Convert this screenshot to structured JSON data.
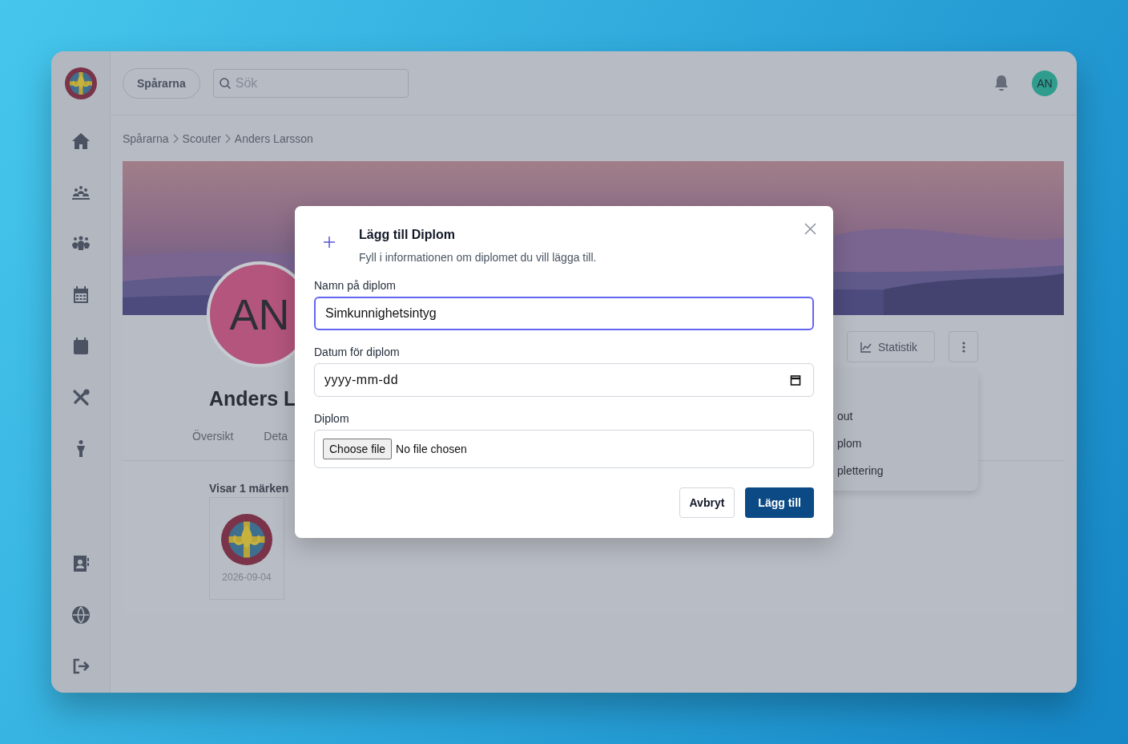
{
  "header": {
    "org_button": "Spårarna",
    "search": {
      "placeholder": "Sök"
    },
    "user_initials": "AN"
  },
  "breadcrumb": [
    "Spårarna",
    "Scouter",
    "Anders Larsson"
  ],
  "profile": {
    "avatar_initials": "AN",
    "name": "Anders L",
    "tabs": [
      "Översikt",
      "Deta"
    ],
    "statistics_button": "Statistik",
    "menu_items": [
      "out",
      "plom",
      "plettering"
    ]
  },
  "badges": {
    "summary": "Visar 1 märken",
    "items": [
      {
        "date": "2026-09-04"
      }
    ]
  },
  "modal": {
    "title": "Lägg till Diplom",
    "subtitle": "Fyll i informationen om diplomet du vill lägga till.",
    "fields": [
      {
        "kind": "text",
        "label": "Namn på diplom",
        "value": "Simkunnighetsintyg",
        "focused": true
      },
      {
        "kind": "date",
        "label": "Datum för diplom",
        "placeholder": "yyyy-mm-dd",
        "focused": false
      },
      {
        "kind": "file",
        "label": "Diplom",
        "button": "Choose file",
        "status": "No file chosen",
        "focused": false
      }
    ],
    "cancel": "Avbryt",
    "submit": "Lägg till"
  }
}
